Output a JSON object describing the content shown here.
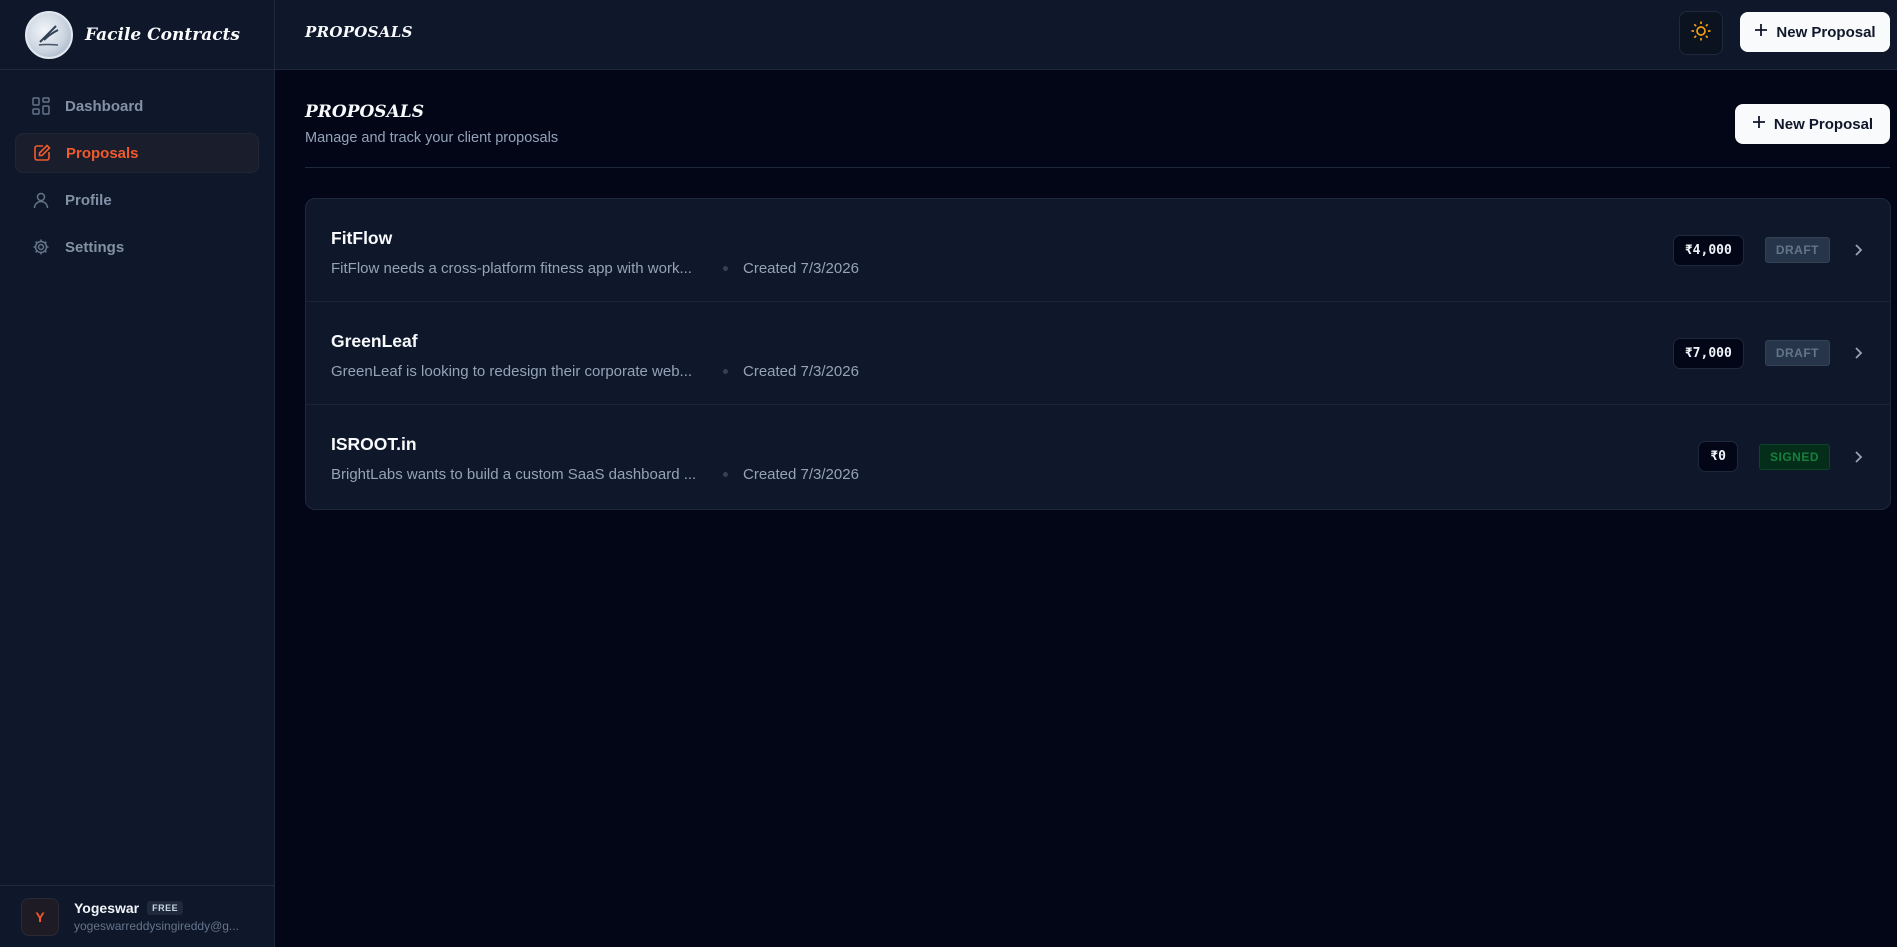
{
  "app": {
    "name": "Facile Contracts"
  },
  "sidebar": {
    "items": [
      {
        "label": "Dashboard",
        "icon": "dashboard-icon"
      },
      {
        "label": "Proposals",
        "icon": "edit-document-icon",
        "active": true
      },
      {
        "label": "Profile",
        "icon": "user-icon"
      },
      {
        "label": "Settings",
        "icon": "gear-icon"
      }
    ],
    "user": {
      "initial": "Y",
      "name": "Yogeswar",
      "plan": "FREE",
      "email": "yogeswarreddysingireddy@g..."
    }
  },
  "topbar": {
    "title": "PROPOSALS",
    "new_button": "New Proposal",
    "theme_icon": "sun-icon"
  },
  "main": {
    "title": "PROPOSALS",
    "subtitle": "Manage and track your client proposals",
    "new_button": "New Proposal"
  },
  "proposals": [
    {
      "title": "FitFlow",
      "description": "FitFlow needs a cross-platform fitness app with work...",
      "created": "Created 7/3/2026",
      "amount": "₹4,000",
      "status": "DRAFT"
    },
    {
      "title": "GreenLeaf",
      "description": "GreenLeaf is looking to redesign their corporate web...",
      "created": "Created 7/3/2026",
      "amount": "₹7,000",
      "status": "DRAFT"
    },
    {
      "title": "ISROOT.in",
      "description": "BrightLabs wants to build a custom SaaS dashboard ...",
      "created": "Created 7/3/2026",
      "amount": "₹0",
      "status": "SIGNED"
    }
  ],
  "colors": {
    "accent": "#f05a2c",
    "background": "#020617",
    "panel": "#0f172a",
    "signed": "#15803d"
  }
}
